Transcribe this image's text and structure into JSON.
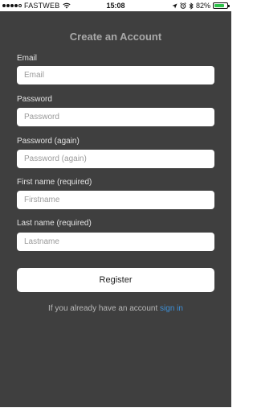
{
  "status_bar": {
    "carrier": "FASTWEB",
    "time": "15:08",
    "battery_percent": "82%",
    "battery_level": 0.82,
    "battery_color": "#2dc24a",
    "icons": [
      "signal-dots-icon",
      "wifi-icon",
      "location-arrow-icon",
      "alarm-icon",
      "bluetooth-icon",
      "battery-icon"
    ]
  },
  "form": {
    "title": "Create an Account",
    "fields": [
      {
        "label": "Email",
        "placeholder": "Email",
        "value": ""
      },
      {
        "label": "Password",
        "placeholder": "Password",
        "value": ""
      },
      {
        "label": "Password (again)",
        "placeholder": "Password (again)",
        "value": ""
      },
      {
        "label": "First name (required)",
        "placeholder": "Firstname",
        "value": ""
      },
      {
        "label": "Last name (required)",
        "placeholder": "Lastname",
        "value": ""
      }
    ],
    "register_label": "Register",
    "signin_prompt": "If you already have an account",
    "signin_link": "sign in"
  },
  "colors": {
    "background": "#3f3f3f",
    "title": "#a9a9a9",
    "label": "#e4e4e4",
    "link": "#3d8fd6"
  }
}
